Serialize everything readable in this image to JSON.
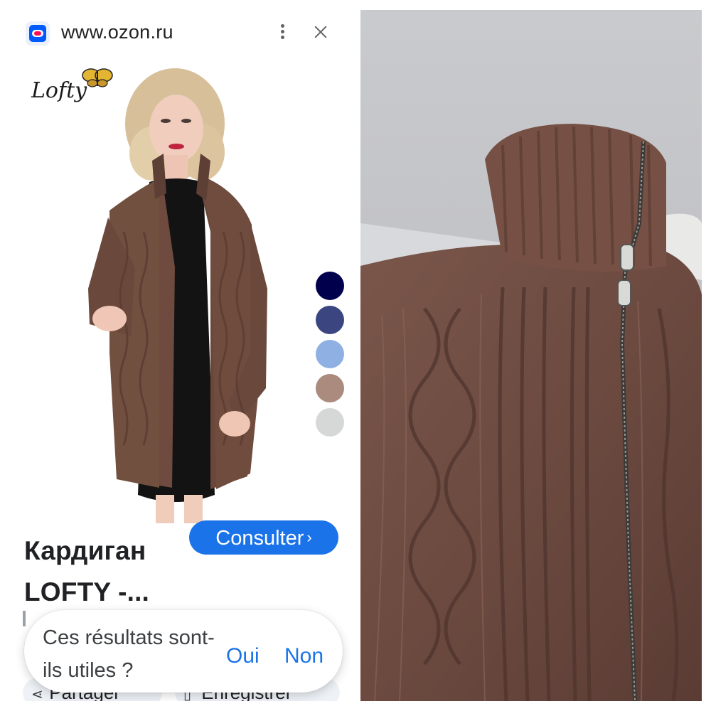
{
  "browser": {
    "url": "www.ozon.ru"
  },
  "product": {
    "brand": "Lofty",
    "title": "Кардиган LOFTY -...",
    "consult_label": "Consulter",
    "consult_chevron": "›",
    "swatches": [
      {
        "color": "#00004d"
      },
      {
        "color": "#3b4680"
      },
      {
        "color": "#8fb0e3"
      },
      {
        "color": "#aa8b7d"
      },
      {
        "color": "#d6d8d7"
      }
    ]
  },
  "feedback": {
    "question": "Ces résultats sont-ils utiles ?",
    "yes": "Oui",
    "no": "Non"
  },
  "actions": {
    "share": "Partager",
    "save": "Enregistrer"
  }
}
